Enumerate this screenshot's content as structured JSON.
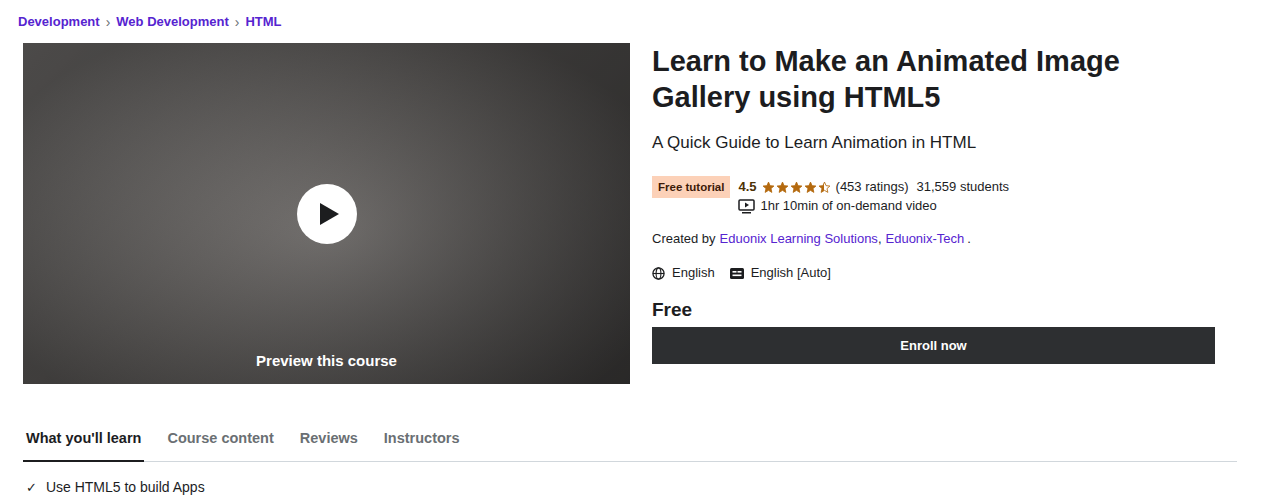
{
  "breadcrumb": [
    {
      "label": "Development"
    },
    {
      "label": "Web Development"
    },
    {
      "label": "HTML"
    }
  ],
  "breadcrumb_separator": "›",
  "preview": {
    "label": "Preview this course"
  },
  "course": {
    "title": "Learn to Make an Animated Image Gallery using HTML5",
    "subtitle": "A Quick Guide to Learn Animation in HTML",
    "badge": "Free tutorial",
    "rating": "4.5",
    "stars": 4.5,
    "ratings": "(453 ratings)",
    "students": "31,559 students",
    "video": "1hr 10min of on-demand video",
    "created_by_label": "Created by",
    "authors": [
      {
        "name": "Eduonix Learning Solutions"
      },
      {
        "name": "Eduonix-Tech"
      }
    ],
    "author_separator": ",",
    "created_by_end": ".",
    "language": "English",
    "captions": "English [Auto]",
    "price": "Free",
    "enroll": "Enroll now"
  },
  "tabs": [
    {
      "label": "What you'll learn",
      "selected": true
    },
    {
      "label": "Course content",
      "selected": false
    },
    {
      "label": "Reviews",
      "selected": false
    },
    {
      "label": "Instructors",
      "selected": false
    }
  ],
  "learn_items": [
    {
      "mark": "✓",
      "text": "Use HTML5 to build Apps"
    }
  ]
}
